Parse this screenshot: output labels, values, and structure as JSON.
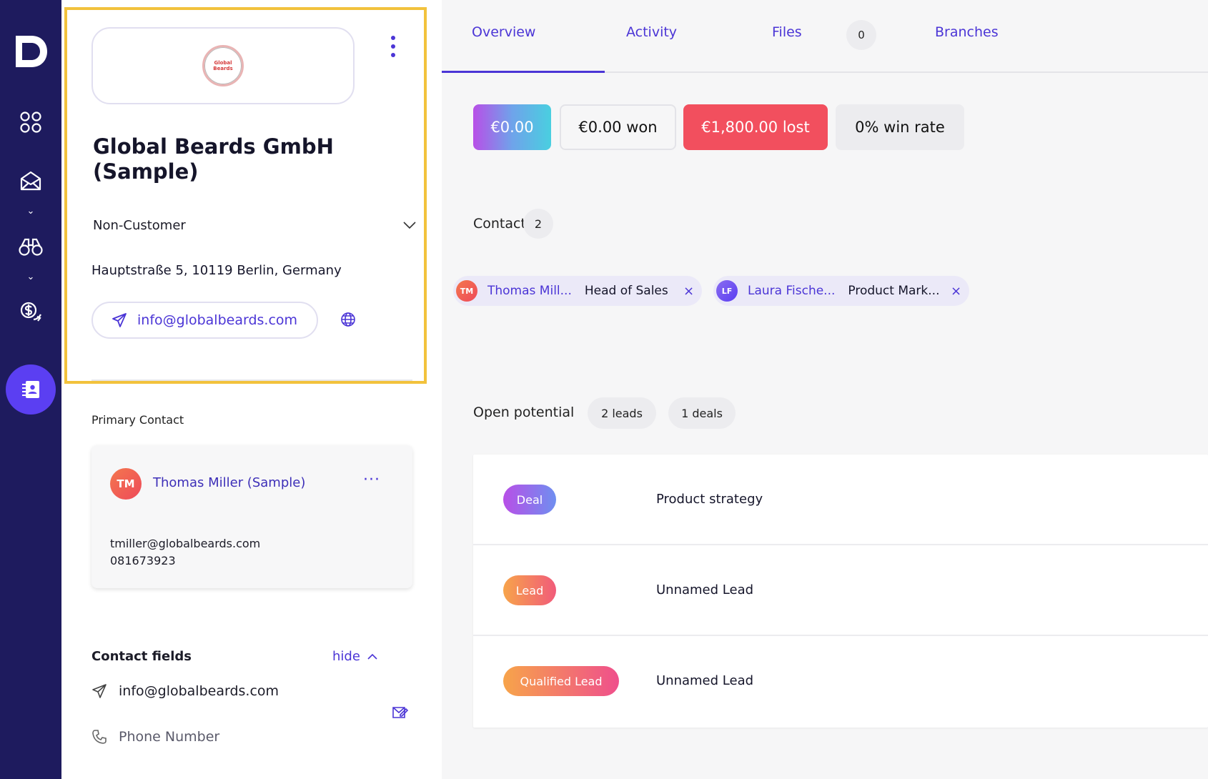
{
  "nav": {
    "items": [
      "grid-icon",
      "mail-icon",
      "binoculars-icon",
      "money-icon",
      "contacts-icon"
    ],
    "active": "contacts-icon",
    "caret": "⌄"
  },
  "company": {
    "logo_text_line1": "Global",
    "logo_text_line2": "Beards",
    "name": "Global Beards GmbH (Sample)",
    "status": "Non-Customer",
    "address": "Hauptstraße 5, 10119 Berlin, Germany",
    "email": "info@globalbeards.com"
  },
  "primary_contact": {
    "label": "Primary Contact",
    "initials": "TM",
    "name": "Thomas Miller (Sample)",
    "email": "tmiller@globalbeards.com",
    "phone": "081673923",
    "menu": "···"
  },
  "contact_fields": {
    "title": "Contact fields",
    "toggle": "hide",
    "email": "info@globalbeards.com",
    "phone_placeholder": "Phone Number"
  },
  "tabs": {
    "overview": "Overview",
    "activity": "Activity",
    "files": "Files",
    "files_count": "0",
    "branches": "Branches"
  },
  "stats": {
    "total": "€0.00",
    "won": "€0.00 won",
    "lost": "€1,800.00 lost",
    "win_rate": "0% win rate"
  },
  "contacts": {
    "label": "Contacts",
    "count": "2",
    "items": [
      {
        "initials": "TM",
        "name": "Thomas Mill...",
        "role": "Head of Sales"
      },
      {
        "initials": "LF",
        "name": "Laura Fische...",
        "role": "Product Mark..."
      }
    ],
    "remove": "×"
  },
  "open_potential": {
    "label": "Open potential",
    "leads": "2 leads",
    "deals": "1 deals",
    "rows": [
      {
        "tag": "Deal",
        "title": "Product strategy"
      },
      {
        "tag": "Lead",
        "title": "Unnamed Lead"
      },
      {
        "tag": "Qualified Lead",
        "title": "Unnamed Lead"
      }
    ]
  },
  "colors": {
    "rail": "#1e1b5e",
    "accent": "#4b35d6",
    "highlight": "#f2c23c",
    "lost": "#f24f5e"
  }
}
